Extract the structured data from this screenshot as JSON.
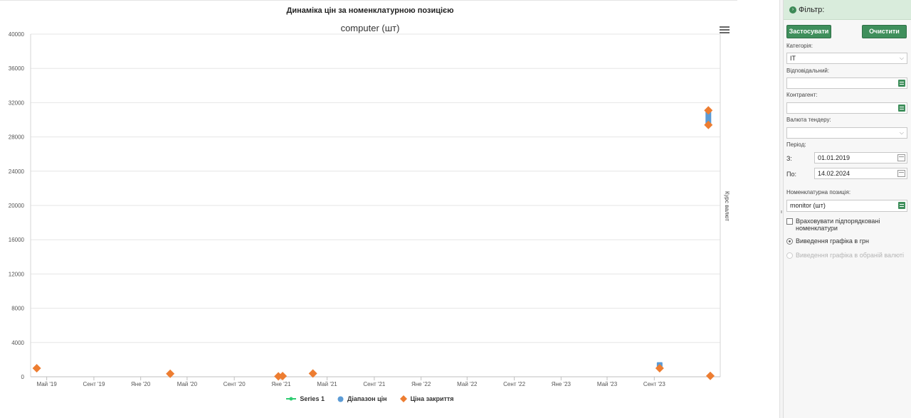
{
  "page": {
    "title": "Динаміка цін за номенклатурною позицією"
  },
  "chart_data": {
    "type": "scatter",
    "title": "computer (шт)",
    "ylabel_right": "Курс валют",
    "ylim": [
      0,
      40000
    ],
    "yticks": [
      0,
      4000,
      8000,
      12000,
      16000,
      20000,
      24000,
      28000,
      32000,
      36000,
      40000
    ],
    "xlim": [
      "2019-03-20",
      "2024-02-20"
    ],
    "xticks": [
      {
        "date": "2019-05-01",
        "label": "Май '19"
      },
      {
        "date": "2019-09-01",
        "label": "Сент '19"
      },
      {
        "date": "2020-01-01",
        "label": "Яне '20"
      },
      {
        "date": "2020-05-01",
        "label": "Май '20"
      },
      {
        "date": "2020-09-01",
        "label": "Сент '20"
      },
      {
        "date": "2021-01-01",
        "label": "Яне '21"
      },
      {
        "date": "2021-05-01",
        "label": "Май '21"
      },
      {
        "date": "2021-09-01",
        "label": "Сент '21"
      },
      {
        "date": "2022-01-01",
        "label": "Яне '22"
      },
      {
        "date": "2022-05-01",
        "label": "Май '22"
      },
      {
        "date": "2022-09-01",
        "label": "Сент '22"
      },
      {
        "date": "2023-01-01",
        "label": "Яне '23"
      },
      {
        "date": "2023-05-01",
        "label": "Май '23"
      },
      {
        "date": "2023-09-01",
        "label": "Сент '23"
      }
    ],
    "grid": true,
    "legend_position": "bottom-center",
    "series": [
      {
        "name": "Series 1",
        "color": "#2ecc71",
        "marker": "line",
        "points": []
      },
      {
        "name": "Діапазон цін",
        "color": "#5b9bd5",
        "marker": "range",
        "points": [
          {
            "x": "2023-09-15",
            "low": 1000,
            "high": 1700
          },
          {
            "x": "2024-01-20",
            "low": 29400,
            "high": 31100
          }
        ]
      },
      {
        "name": "Ціна закриття",
        "color": "#ed7d31",
        "marker": "diamond",
        "points": [
          {
            "x": "2019-04-05",
            "y": 1000
          },
          {
            "x": "2020-03-18",
            "y": 350
          },
          {
            "x": "2020-12-25",
            "y": 50
          },
          {
            "x": "2021-01-05",
            "y": 80
          },
          {
            "x": "2021-03-25",
            "y": 380
          },
          {
            "x": "2023-09-15",
            "y": 1000
          },
          {
            "x": "2024-01-20",
            "y": 31100
          },
          {
            "x": "2024-01-20",
            "y": 29400
          },
          {
            "x": "2024-01-25",
            "y": 100
          }
        ]
      }
    ]
  },
  "filter": {
    "header": "Фільтр:",
    "apply_label": "Застосувати",
    "clear_label": "Очистити",
    "category_label": "Категорія:",
    "category_value": "IT",
    "responsible_label": "Відповідальний:",
    "responsible_value": "",
    "counterparty_label": "Контрагент:",
    "counterparty_value": "",
    "currency_label": "Валюта тендеру:",
    "currency_value": "",
    "period_label": "Період:",
    "from_label": "З:",
    "from_value": "01.01.2019",
    "to_label": "По:",
    "to_value": "14.02.2024",
    "item_label": "Номенклатурна позиція:",
    "item_value": "monitor (шт)",
    "include_sub_label": "Враховувати підпорядковані номенклатури",
    "include_sub_checked": false,
    "radio_uah_label": "Виведення графіка в грн",
    "radio_currency_label": "Виведення графіка в обраній валюті"
  },
  "colors": {
    "accent_green": "#3f8f5c",
    "header_green": "#d9ecdc",
    "series_blue": "#5b9bd5",
    "series_orange": "#ed7d31",
    "series_green": "#2ecc71"
  }
}
